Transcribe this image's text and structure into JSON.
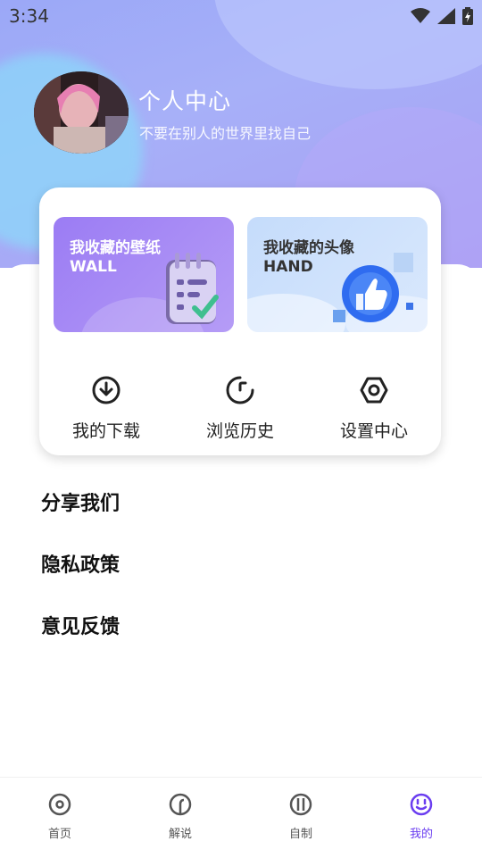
{
  "status_bar": {
    "time": "3:34"
  },
  "profile": {
    "title": "个人中心",
    "subtitle": "不要在别人的世界里找自己"
  },
  "collections": [
    {
      "title": "我收藏的壁纸",
      "subtitle": "WALL"
    },
    {
      "title": "我收藏的头像",
      "subtitle": "HAND"
    }
  ],
  "quick_actions": [
    {
      "label": "我的下载",
      "icon": "download-icon"
    },
    {
      "label": "浏览历史",
      "icon": "history-icon"
    },
    {
      "label": "设置中心",
      "icon": "settings-icon"
    }
  ],
  "menu": [
    {
      "label": "分享我们"
    },
    {
      "label": "隐私政策"
    },
    {
      "label": "意见反馈"
    }
  ],
  "tabs": [
    {
      "label": "首页",
      "icon": "home-icon"
    },
    {
      "label": "解说",
      "icon": "commentary-icon"
    },
    {
      "label": "自制",
      "icon": "create-icon"
    },
    {
      "label": "我的",
      "icon": "smiley-icon",
      "active": true
    }
  ],
  "colors": {
    "accent": "#6a3df0",
    "hero": "#a7b0f8"
  }
}
